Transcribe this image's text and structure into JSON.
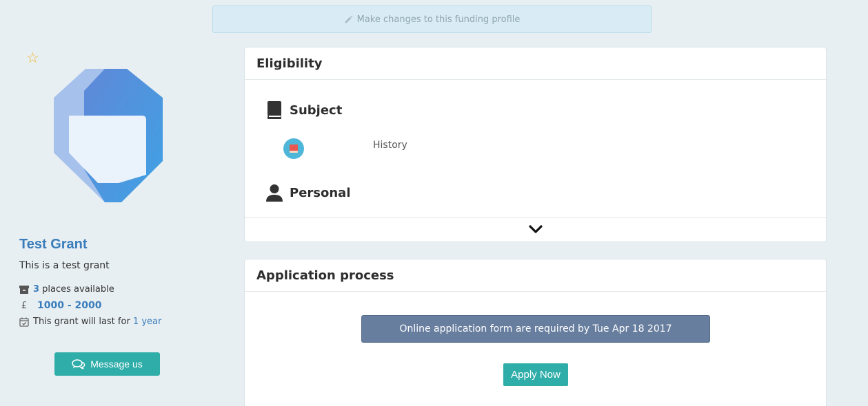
{
  "banner": {
    "label": "Make changes to this funding profile"
  },
  "profile": {
    "title": "Test Grant",
    "description": "This is a test grant",
    "places_count": "3",
    "places_suffix": " places available",
    "currency_symbol": "£",
    "amount_range": "1000 - 2000",
    "duration_prefix": "This grant will last for ",
    "duration_value": "1 year",
    "message_button": "Message us"
  },
  "eligibility": {
    "title": "Eligibility",
    "subject_heading": "Subject",
    "subject_item": "History",
    "personal_heading": "Personal"
  },
  "application": {
    "title": "Application process",
    "deadline_text": "Online application form are required by Tue Apr 18 2017",
    "apply_button": "Apply Now"
  },
  "colors": {
    "accent_blue": "#3a7dbb",
    "teal_button": "#2fada9",
    "deadline_bg": "#687e9f",
    "star": "#f1b52b"
  },
  "icons": {
    "banner": "pencil-icon",
    "favourite": "star-outline-icon",
    "places": "archive-box-icon",
    "duration": "calendar-check-icon",
    "message": "chat-bubbles-icon",
    "subject": "book-icon",
    "subject_item": "history-book-icon",
    "personal": "person-icon",
    "expand": "chevron-down-icon"
  }
}
